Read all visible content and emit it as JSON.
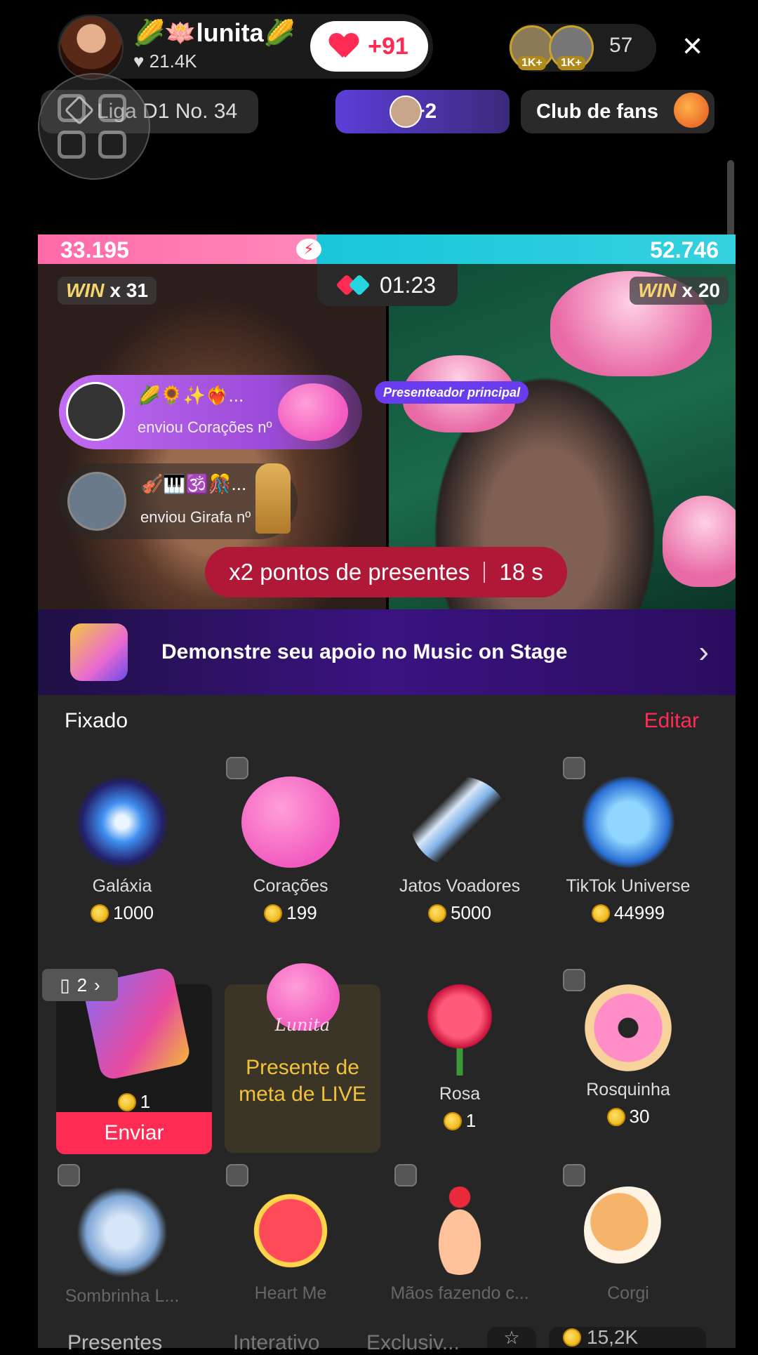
{
  "host": {
    "name": "🌽🪷lunita🌽",
    "likes": "21.4K",
    "like_plus": "+91"
  },
  "viewers": {
    "badge1": "1K+",
    "badge2": "1K+",
    "count": "57"
  },
  "close_icon": "×",
  "league": "Liga D1 No. 34",
  "plus_viewers": "+2",
  "fans_club": "Club de fans",
  "battle": {
    "score_left": "33.195",
    "score_right": "52.746",
    "win_label": "WIN",
    "win_left": "x 31",
    "win_right": "x 20",
    "timer": "01:23",
    "host_tag": "Presenteador principal",
    "notif1_name": "🌽🌻✨❤️‍🔥...",
    "notif1_sub": "enviou Corações nº",
    "notif2_name": "🎻🎹🕉️🎊...",
    "notif2_sub": "enviou Girafa nº",
    "boost_text": "x2 pontos de presentes",
    "boost_time": "18 s"
  },
  "music_banner": "Demonstre seu apoio no Music on Stage",
  "panel": {
    "fixed_label": "Fixado",
    "edit_label": "Editar",
    "pinned": [
      {
        "name": "Galáxia",
        "price": "1000"
      },
      {
        "name": "Corações",
        "price": "199"
      },
      {
        "name": "Jatos Voadores",
        "price": "5000"
      },
      {
        "name": "TikTok Universe",
        "price": "44999"
      }
    ],
    "row2": {
      "ticket_count": "2",
      "selected_price": "1",
      "send_label": "Enviar",
      "goal_text_1": "Presente de",
      "goal_text_2": "meta de LIVE",
      "goal_logo": "Lunita",
      "rose_name": "Rosa",
      "rose_price": "1",
      "donut_name": "Rosquinha",
      "donut_price": "30"
    },
    "row3": [
      "Sombrinha L...",
      "Heart Me",
      "Mãos fazendo c...",
      "Corgi"
    ]
  },
  "tabs": [
    "Presentes",
    "Interativo",
    "Exclusiv..."
  ],
  "balance": "15,2K"
}
